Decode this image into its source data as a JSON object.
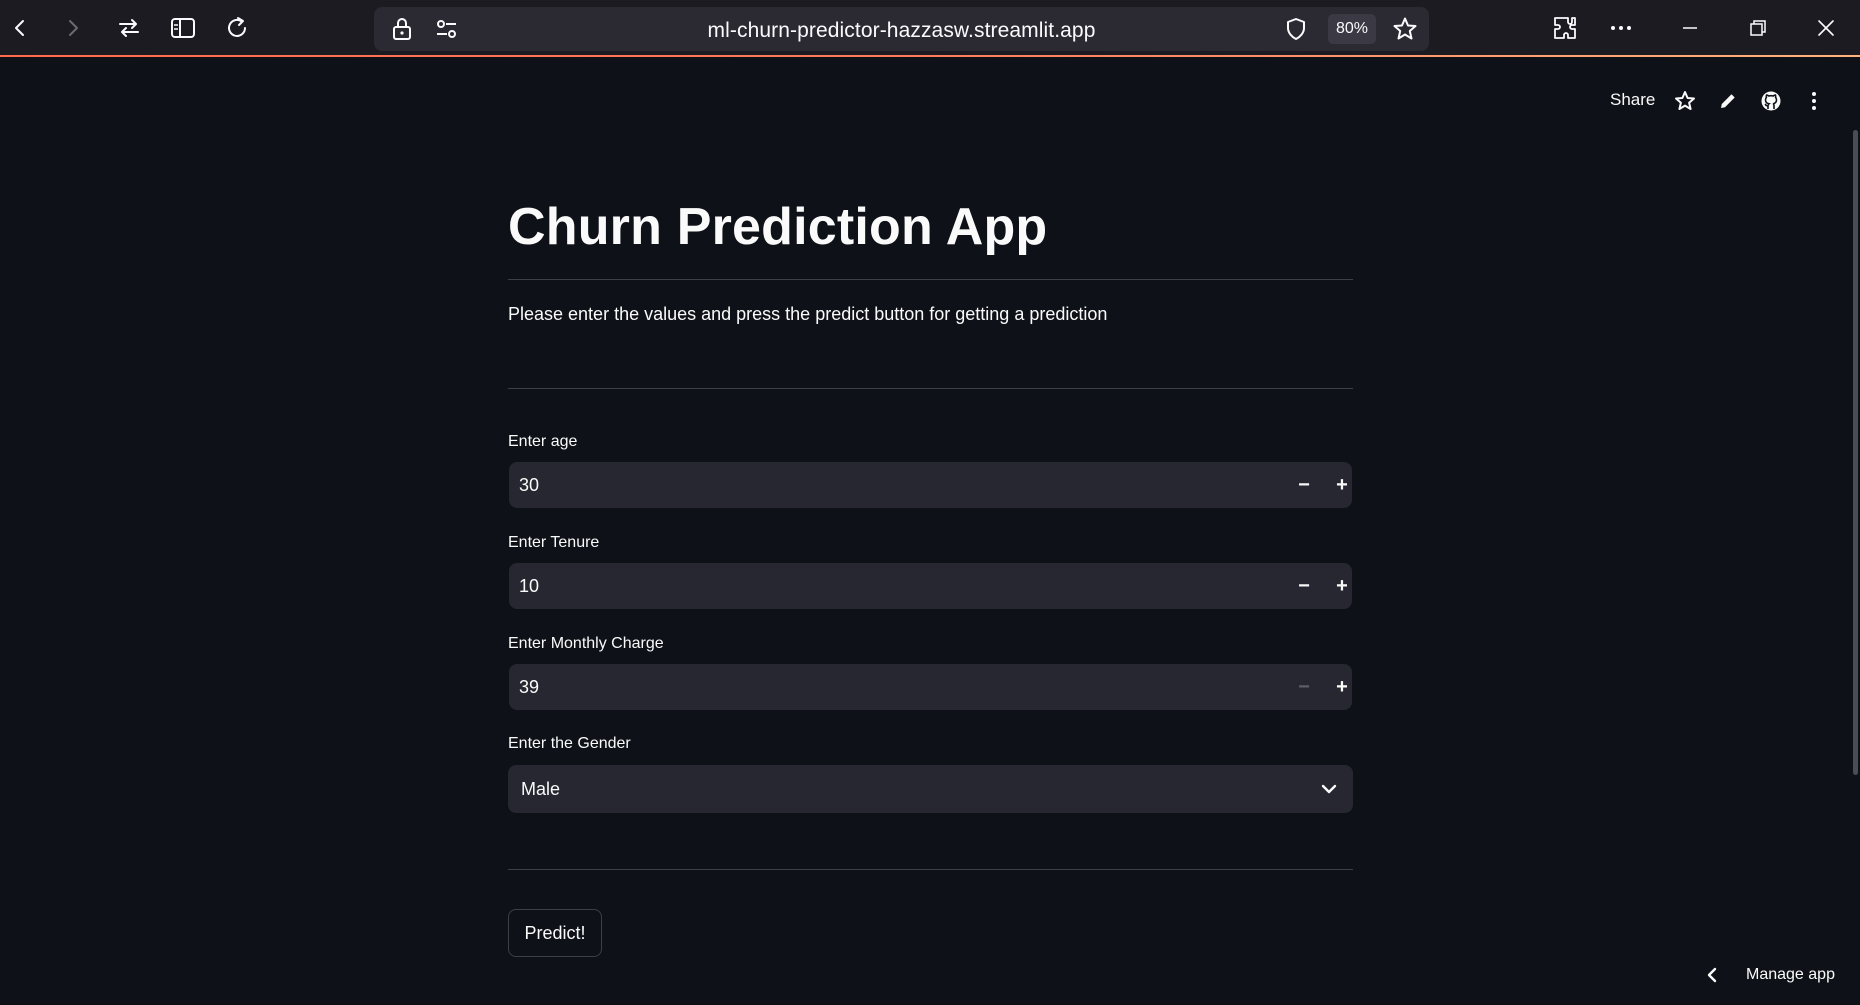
{
  "browser": {
    "url": "ml-churn-predictor-hazzasw.streamlit.app",
    "zoom": "80%",
    "icons": [
      "back-icon",
      "forward-icon",
      "swap-icon",
      "reader-view-icon",
      "reload-icon",
      "lock-icon",
      "site-settings-icon",
      "shield-icon",
      "bookmark-star-icon",
      "extensions-icon",
      "more-icon",
      "minimize-icon",
      "restore-icon",
      "close-icon"
    ]
  },
  "app_header": {
    "share_label": "Share",
    "icons": [
      "star-icon",
      "edit-icon",
      "github-icon",
      "kebab-menu-icon"
    ]
  },
  "main": {
    "title": "Churn Prediction App",
    "subtitle": "Please enter the values and press the predict button for getting a prediction",
    "fields": [
      {
        "label": "Enter age",
        "value": "30",
        "minus_disabled": false
      },
      {
        "label": "Enter Tenure",
        "value": "10",
        "minus_disabled": false
      },
      {
        "label": "Enter Monthly Charge",
        "value": "39",
        "minus_disabled": true
      }
    ],
    "gender": {
      "label": "Enter the Gender",
      "value": "Male"
    },
    "predict_label": "Predict!"
  },
  "footer": {
    "manage_app_label": "Manage app"
  },
  "colors": {
    "background": "#0e1117",
    "input_bg": "#262730",
    "browser_chrome": "#1c1b22",
    "text": "#fafafa"
  }
}
